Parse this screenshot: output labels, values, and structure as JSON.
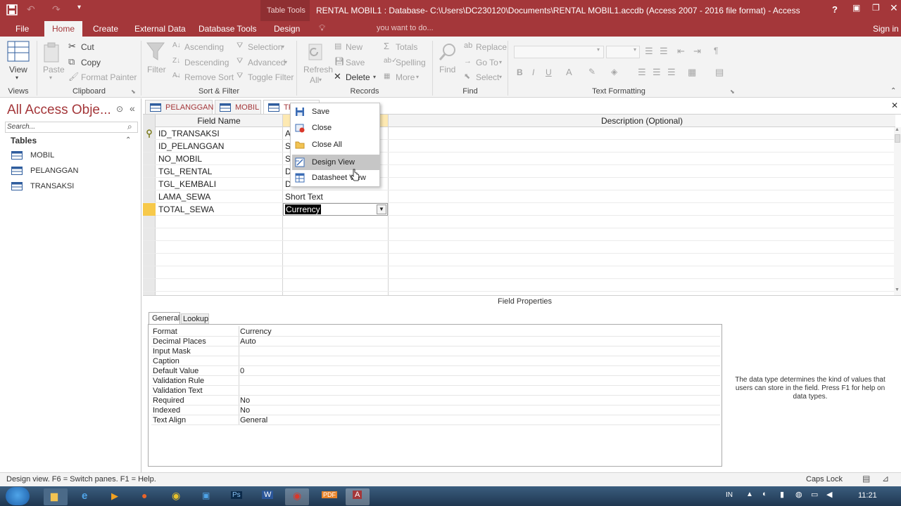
{
  "titlebar": {
    "context_tab": "Table Tools",
    "title": "RENTAL MOBIL1 : Database- C:\\Users\\DC230120\\Documents\\RENTAL MOBIL1.accdb (Access 2007 - 2016 file format) - Access",
    "help": "?"
  },
  "tabs": [
    {
      "label": "File"
    },
    {
      "label": "Home"
    },
    {
      "label": "Create"
    },
    {
      "label": "External Data"
    },
    {
      "label": "Database Tools"
    },
    {
      "label": "Design"
    }
  ],
  "tell_me": "you want to do...",
  "sign_in": "Sign in",
  "ribbon": {
    "views": {
      "view": "View",
      "group": "Views"
    },
    "clipboard": {
      "paste": "Paste",
      "cut": "Cut",
      "copy": "Copy",
      "format_painter": "Format Painter",
      "group": "Clipboard"
    },
    "sort_filter": {
      "filter": "Filter",
      "ascending": "Ascending",
      "descending": "Descending",
      "remove_sort": "Remove Sort",
      "selection": "Selection",
      "advanced": "Advanced",
      "toggle_filter": "Toggle Filter",
      "group": "Sort & Filter"
    },
    "records": {
      "refresh": "Refresh",
      "refresh_all": "All",
      "new": "New",
      "save": "Save",
      "delete": "Delete",
      "totals": "Totals",
      "spelling": "Spelling",
      "more": "More",
      "group": "Records"
    },
    "find": {
      "find": "Find",
      "replace": "Replace",
      "goto": "Go To",
      "select": "Select",
      "group": "Find"
    },
    "text_formatting": {
      "bold": "B",
      "italic": "I",
      "underline": "U",
      "group": "Text Formatting"
    }
  },
  "nav": {
    "title": "All Access Obje...",
    "search_placeholder": "Search...",
    "section": "Tables",
    "items": [
      {
        "label": "MOBIL"
      },
      {
        "label": "PELANGGAN"
      },
      {
        "label": "TRANSAKSI"
      }
    ]
  },
  "doc_tabs": [
    {
      "label": "PELANGGAN"
    },
    {
      "label": "MOBIL"
    },
    {
      "label": "TR"
    }
  ],
  "grid": {
    "header_field": "Field Name",
    "header_desc": "Description (Optional)",
    "rows": [
      {
        "field": "ID_TRANSAKSI",
        "type": "A"
      },
      {
        "field": "ID_PELANGGAN",
        "type": "S"
      },
      {
        "field": "NO_MOBIL",
        "type": "S"
      },
      {
        "field": "TGL_RENTAL",
        "type": "D"
      },
      {
        "field": "TGL_KEMBALI",
        "type": "D"
      },
      {
        "field": "LAMA_SEWA",
        "type": "Short Text"
      },
      {
        "field": "TOTAL_SEWA",
        "type": "Currency"
      }
    ]
  },
  "context_menu": {
    "items": [
      {
        "label": "Save"
      },
      {
        "label": "Close"
      },
      {
        "label": "Close All"
      },
      {
        "label": "Design View"
      },
      {
        "label": "Datasheet View"
      }
    ]
  },
  "field_properties": {
    "title": "Field Properties",
    "tabs": [
      {
        "label": "General"
      },
      {
        "label": "Lookup"
      }
    ],
    "rows": [
      {
        "name": "Format",
        "value": "Currency"
      },
      {
        "name": "Decimal Places",
        "value": "Auto"
      },
      {
        "name": "Input Mask",
        "value": ""
      },
      {
        "name": "Caption",
        "value": ""
      },
      {
        "name": "Default Value",
        "value": "0"
      },
      {
        "name": "Validation Rule",
        "value": ""
      },
      {
        "name": "Validation Text",
        "value": ""
      },
      {
        "name": "Required",
        "value": "No"
      },
      {
        "name": "Indexed",
        "value": "No"
      },
      {
        "name": "Text Align",
        "value": "General"
      }
    ],
    "help": "The data type determines the kind of values that users can store in the field. Press F1 for help on data types."
  },
  "status": {
    "left": "Design view.  F6 = Switch panes.  F1 = Help.",
    "caps": "Caps Lock"
  },
  "taskbar": {
    "lang": "IN",
    "time": "11:21"
  },
  "colors": {
    "accent": "#a4373a",
    "ribbon_bg": "#f3f3f3"
  }
}
